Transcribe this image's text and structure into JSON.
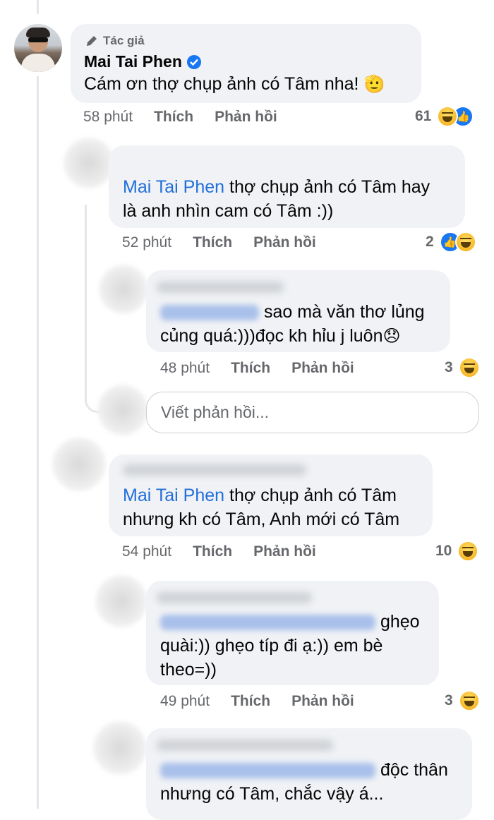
{
  "comments": [
    {
      "author_role": "Tác giả",
      "author_name": "Mai Tai Phen",
      "text": "Cám ơn thợ chụp ảnh có Tâm nha!",
      "emoji_in_text": "🫡",
      "time": "58 phút",
      "like_label": "Thích",
      "reply_label": "Phản hồi",
      "reaction_count": "61",
      "reactions": [
        "haha-icon",
        "like-icon"
      ]
    },
    {
      "mention": "Mai Tai Phen",
      "text_line1": " thợ chụp ảnh có Tâm hay",
      "text_line2": "là anh nhìn cam có Tâm :))",
      "time": "52 phút",
      "like_label": "Thích",
      "reply_label": "Phản hồi",
      "reaction_count": "2",
      "reactions": [
        "like-icon",
        "haha-icon"
      ]
    },
    {
      "text_line1": "sao mà văn thơ lủng",
      "text_line2": "củng quá:)))đọc kh hỉu j luôn",
      "emoji_in_text": "😞",
      "time": "48 phút",
      "like_label": "Thích",
      "reply_label": "Phản hồi",
      "reaction_count": "3",
      "reactions": [
        "haha-icon"
      ]
    },
    {
      "mention": "Mai Tai Phen",
      "text_line1": " thợ chụp ảnh có Tâm",
      "text_line2": "nhưng kh có Tâm, Anh mới có Tâm",
      "time": "54 phút",
      "like_label": "Thích",
      "reply_label": "Phản hồi",
      "reaction_count": "10",
      "reactions": [
        "haha-icon"
      ]
    },
    {
      "text_line1": "ghẹo",
      "text_line2": "quài:)) ghẹo típ đi ạ:)) em bè",
      "text_line3": "theo=))",
      "time": "49 phút",
      "like_label": "Thích",
      "reply_label": "Phản hồi",
      "reaction_count": "3",
      "reactions": [
        "haha-icon"
      ]
    },
    {
      "text_line1": "độc thân",
      "text_line2": "nhưng có Tâm, chắc vậy á..."
    }
  ],
  "reply_input": {
    "placeholder": "Viết phản hồi..."
  },
  "colors": {
    "bubble": "#f0f2f5",
    "mention": "#216fdb",
    "meta": "#65676b",
    "verified": "#1877f2"
  }
}
